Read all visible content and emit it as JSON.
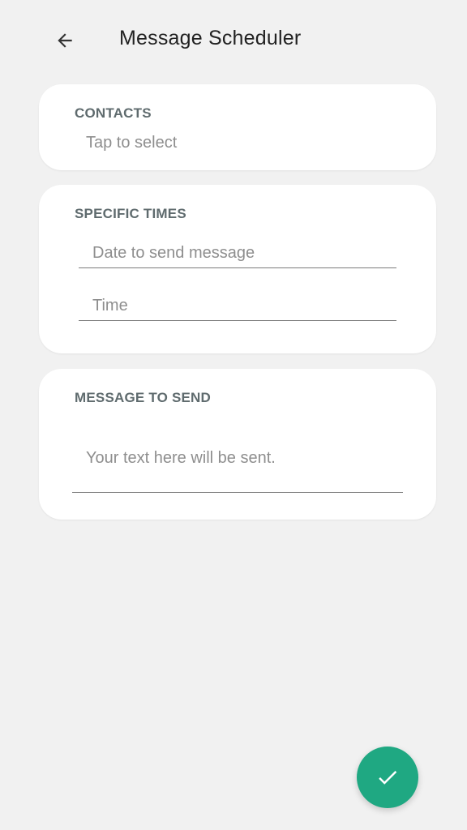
{
  "appbar": {
    "title": "Message Scheduler",
    "back_icon": "arrow-back-icon"
  },
  "contacts": {
    "label": "CONTACTS",
    "placeholder": "Tap to select"
  },
  "specific_times": {
    "label": "SPECIFIC TIMES",
    "date_placeholder": "Date to send message",
    "time_placeholder": "Time"
  },
  "message": {
    "label": "MESSAGE TO SEND",
    "placeholder": "Your text here will be sent."
  },
  "fab": {
    "icon": "check-icon",
    "color": "#1fa882"
  },
  "colors": {
    "background": "#f1f1f1",
    "card": "#ffffff",
    "label": "#5f6b6e",
    "accent": "#1fa882"
  }
}
